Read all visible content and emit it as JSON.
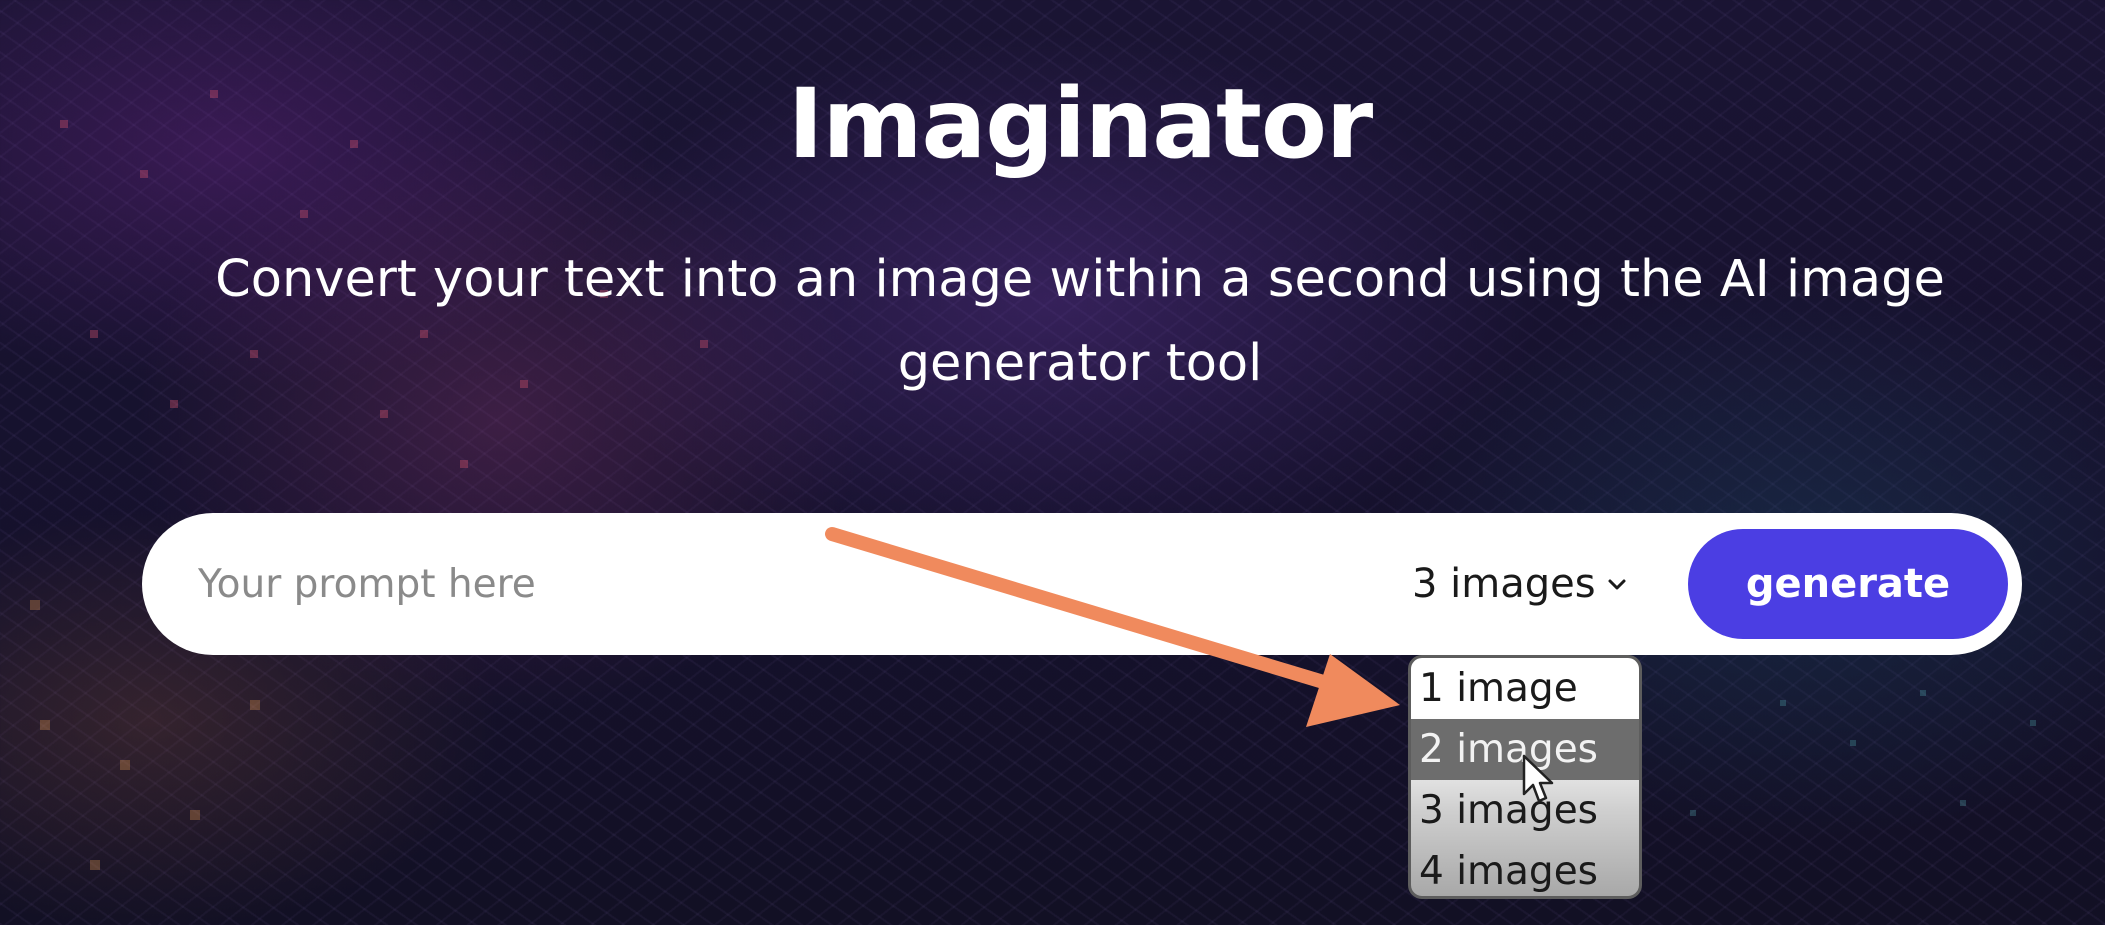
{
  "header": {
    "title": "Imaginator",
    "subtitle": "Convert your text into an image within a second using the AI image generator tool"
  },
  "prompt": {
    "placeholder": "Your prompt here",
    "value": ""
  },
  "image_count": {
    "selected_label": "3 images",
    "icon": "chevron-down-icon",
    "options": [
      "1 image",
      "2 images",
      "3 images",
      "4 images"
    ],
    "highlighted_option": "2 images"
  },
  "generate_button": {
    "label": "generate"
  },
  "colors": {
    "accent": "#4b3ee3",
    "background": "#15112c",
    "annotation_arrow": "#f08a5d"
  }
}
